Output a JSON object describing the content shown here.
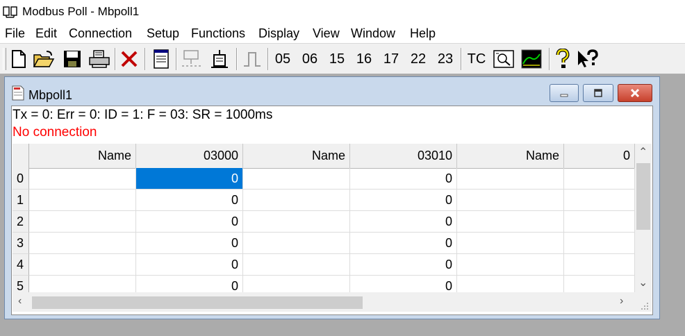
{
  "window": {
    "title": "Modbus Poll - Mbpoll1"
  },
  "menu": [
    "File",
    "Edit",
    "Connection",
    "Setup",
    "Functions",
    "Display",
    "View",
    "Window",
    "Help"
  ],
  "toolbar": {
    "function_codes": [
      "05",
      "06",
      "15",
      "16",
      "17",
      "22",
      "23"
    ],
    "tc_label": "TC"
  },
  "child": {
    "title": "Mbpoll1",
    "status": "Tx = 0: Err = 0: ID = 1: F = 03: SR = 1000ms",
    "error": "No connection"
  },
  "grid": {
    "headers": [
      "Name",
      "03000",
      "Name",
      "03010",
      "Name",
      "0"
    ],
    "rows": [
      {
        "index": "0",
        "v1": "0",
        "v2": "0"
      },
      {
        "index": "1",
        "v1": "0",
        "v2": "0"
      },
      {
        "index": "2",
        "v1": "0",
        "v2": "0"
      },
      {
        "index": "3",
        "v1": "0",
        "v2": "0"
      },
      {
        "index": "4",
        "v1": "0",
        "v2": "0"
      },
      {
        "index": "5",
        "v1": "0",
        "v2": "0"
      }
    ],
    "selected_color": "#0078d7"
  },
  "colors": {
    "error": "#ff0000",
    "desktop": "#ababab",
    "mdi_frame": "#c9d9ec"
  }
}
